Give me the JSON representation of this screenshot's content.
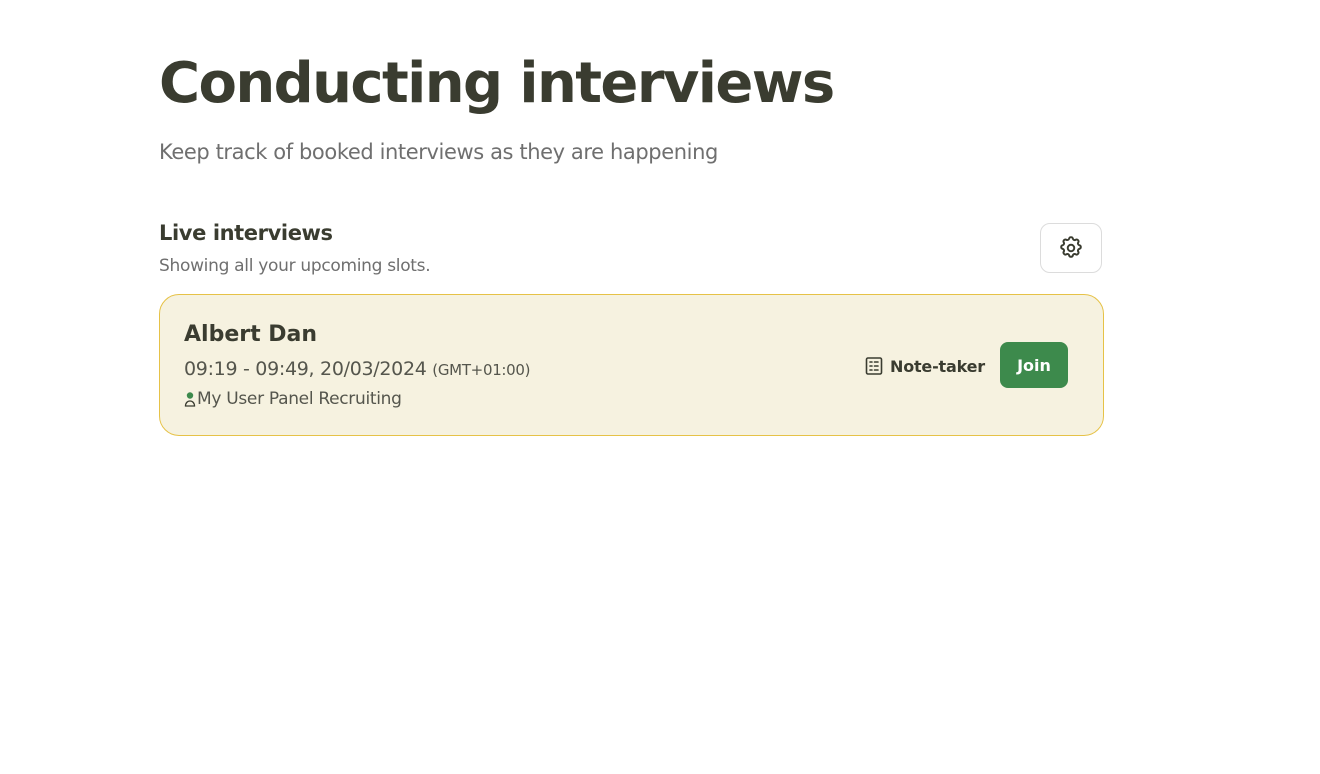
{
  "header": {
    "title": "Conducting interviews",
    "subtitle": "Keep track of booked interviews as they are happening"
  },
  "live_section": {
    "title": "Live interviews",
    "subtitle": "Showing all your upcoming slots.",
    "settings_icon": "gear-icon"
  },
  "interviews": [
    {
      "name": "Albert Dan",
      "time": "09:19 - 09:49, 20/03/2024",
      "timezone": "(GMT+01:00)",
      "study": "My User Panel Recruiting",
      "study_icon": "user-icon",
      "note_taker_label": "Note-taker",
      "note_taker_icon": "document-icon",
      "join_label": "Join"
    }
  ],
  "colors": {
    "card_background": "#f6f2e0",
    "card_border": "#e6c247",
    "join_button": "#3d8a4c",
    "heading_text": "#3a3c30"
  }
}
